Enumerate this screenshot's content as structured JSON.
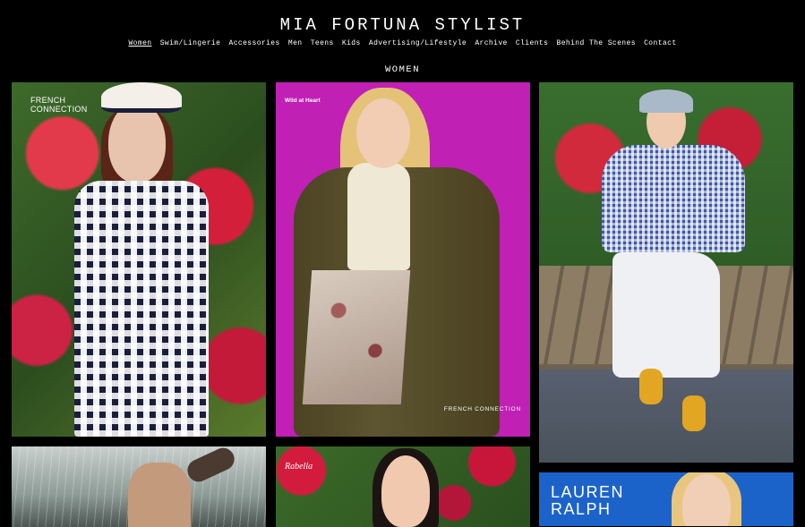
{
  "header": {
    "site_title": "MIA FORTUNA STYLIST",
    "nav": [
      {
        "label": "Women",
        "active": true
      },
      {
        "label": "Swim/Lingerie",
        "active": false
      },
      {
        "label": "Accessories",
        "active": false
      },
      {
        "label": "Men",
        "active": false
      },
      {
        "label": "Teens",
        "active": false
      },
      {
        "label": "Kids",
        "active": false
      },
      {
        "label": "Advertising/Lifestyle",
        "active": false
      },
      {
        "label": "Archive",
        "active": false
      },
      {
        "label": "Clients",
        "active": false
      },
      {
        "label": "Behind The Scenes",
        "active": false
      },
      {
        "label": "Contact",
        "active": false
      }
    ]
  },
  "section": {
    "title": "WOMEN"
  },
  "gallery": {
    "tiles": [
      {
        "overlay_line1": "FRENCH",
        "overlay_line2": "CONNECTION"
      },
      {
        "overlay_top": "Wild at Heart",
        "overlay_bottom": "FRENCH CONNECTION"
      },
      {},
      {},
      {
        "overlay_top": "Rabella"
      },
      {
        "overlay_line1": "LAUREN",
        "overlay_line2": "RALPH"
      }
    ]
  },
  "colors": {
    "background": "#000000",
    "text": "#ffffff",
    "magenta_backdrop": "#c020b4",
    "blue_backdrop": "#1c63c9"
  }
}
